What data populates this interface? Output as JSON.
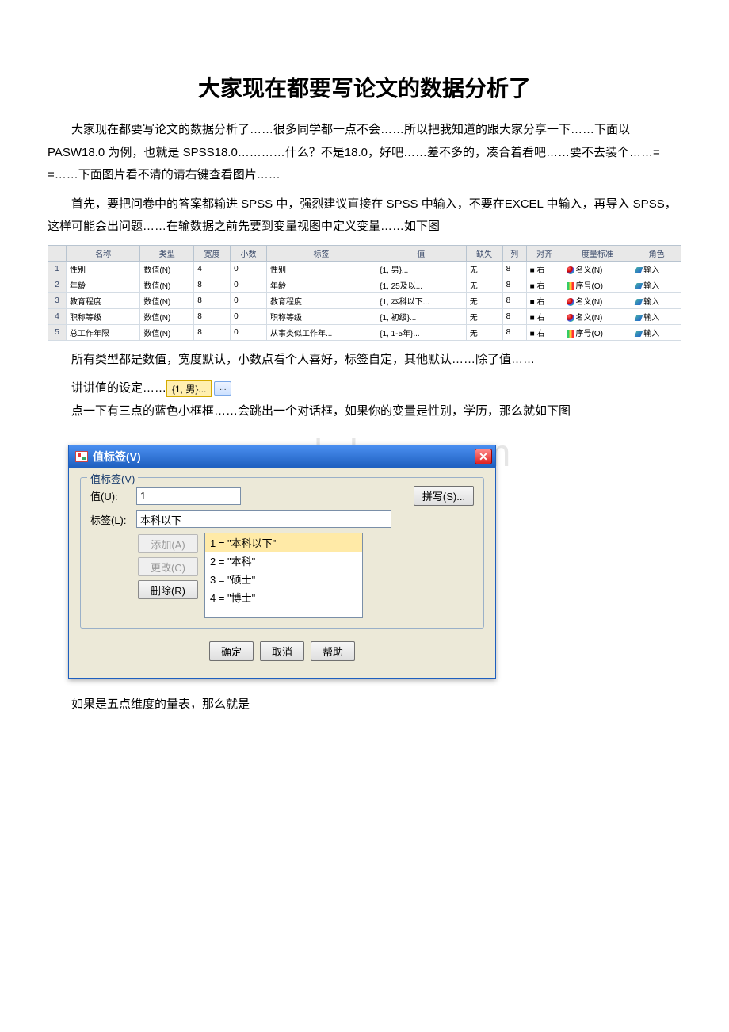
{
  "title": "大家现在都要写论文的数据分析了",
  "para1": "大家现在都要写论文的数据分析了……很多同学都一点不会……所以把我知道的跟大家分享一下……下面以 PASW18.0 为例，也就是 SPSS18.0…………什么？不是18.0，好吧……差不多的，凑合着看吧……要不去装个……= =……下面图片看不清的请右键查看图片……",
  "para2": "首先，要把问卷中的答案都输进 SPSS 中，强烈建议直接在 SPSS 中输入，不要在EXCEL 中输入，再导入 SPSS，这样可能会出问题……在输数据之前先要到变量视图中定义变量……如下图",
  "para3": "所有类型都是数值，宽度默认，小数点看个人喜好，标签自定，其他默认……除了值……",
  "para4_prefix": "讲讲值的设定……",
  "val_cell_text": "{1, 男}...",
  "val_btn_text": "...",
  "para5": "点一下有三点的蓝色小框框……会跳出一个对话框，如果你的变量是性别，学历，那么就如下图",
  "watermark": "www.bdocx.com",
  "para6": "如果是五点维度的量表，那么就是",
  "var_table": {
    "headers": [
      "",
      "名称",
      "类型",
      "宽度",
      "小数",
      "标签",
      "值",
      "缺失",
      "列",
      "对齐",
      "度量标准",
      "角色"
    ],
    "rows": [
      {
        "n": "1",
        "name": "性别",
        "type": "数值(N)",
        "width": "4",
        "dec": "0",
        "label": "性别",
        "val": "{1, 男}...",
        "miss": "无",
        "col": "8",
        "align": "■ 右",
        "measure_icon": "nominal",
        "measure": "名义(N)",
        "role": "输入"
      },
      {
        "n": "2",
        "name": "年龄",
        "type": "数值(N)",
        "width": "8",
        "dec": "0",
        "label": "年龄",
        "val": "{1, 25及以...",
        "miss": "无",
        "col": "8",
        "align": "■ 右",
        "measure_icon": "ordinal",
        "measure": "序号(O)",
        "role": "输入"
      },
      {
        "n": "3",
        "name": "教育程度",
        "type": "数值(N)",
        "width": "8",
        "dec": "0",
        "label": "教育程度",
        "val": "{1, 本科以下...",
        "miss": "无",
        "col": "8",
        "align": "■ 右",
        "measure_icon": "nominal",
        "measure": "名义(N)",
        "role": "输入"
      },
      {
        "n": "4",
        "name": "职称等级",
        "type": "数值(N)",
        "width": "8",
        "dec": "0",
        "label": "职称等级",
        "val": "{1, 初级}...",
        "miss": "无",
        "col": "8",
        "align": "■ 右",
        "measure_icon": "nominal",
        "measure": "名义(N)",
        "role": "输入"
      },
      {
        "n": "5",
        "name": "总工作年限",
        "type": "数值(N)",
        "width": "8",
        "dec": "0",
        "label": "从事类似工作年...",
        "val": "{1, 1-5年}...",
        "miss": "无",
        "col": "8",
        "align": "■ 右",
        "measure_icon": "ordinal",
        "measure": "序号(O)",
        "role": "输入"
      }
    ]
  },
  "dialog": {
    "title": "值标签(V)",
    "legend": "值标签(V)",
    "value_label": "值(U):",
    "value_input": "1",
    "label_label": "标签(L):",
    "label_input": "本科以下",
    "spell": "拼写(S)...",
    "add": "添加(A)",
    "change": "更改(C)",
    "remove": "删除(R)",
    "items": [
      "1 = \"本科以下\"",
      "2 = \"本科\"",
      "3 = \"硕士\"",
      "4 = \"博士\""
    ],
    "ok": "确定",
    "cancel": "取消",
    "help": "帮助"
  }
}
